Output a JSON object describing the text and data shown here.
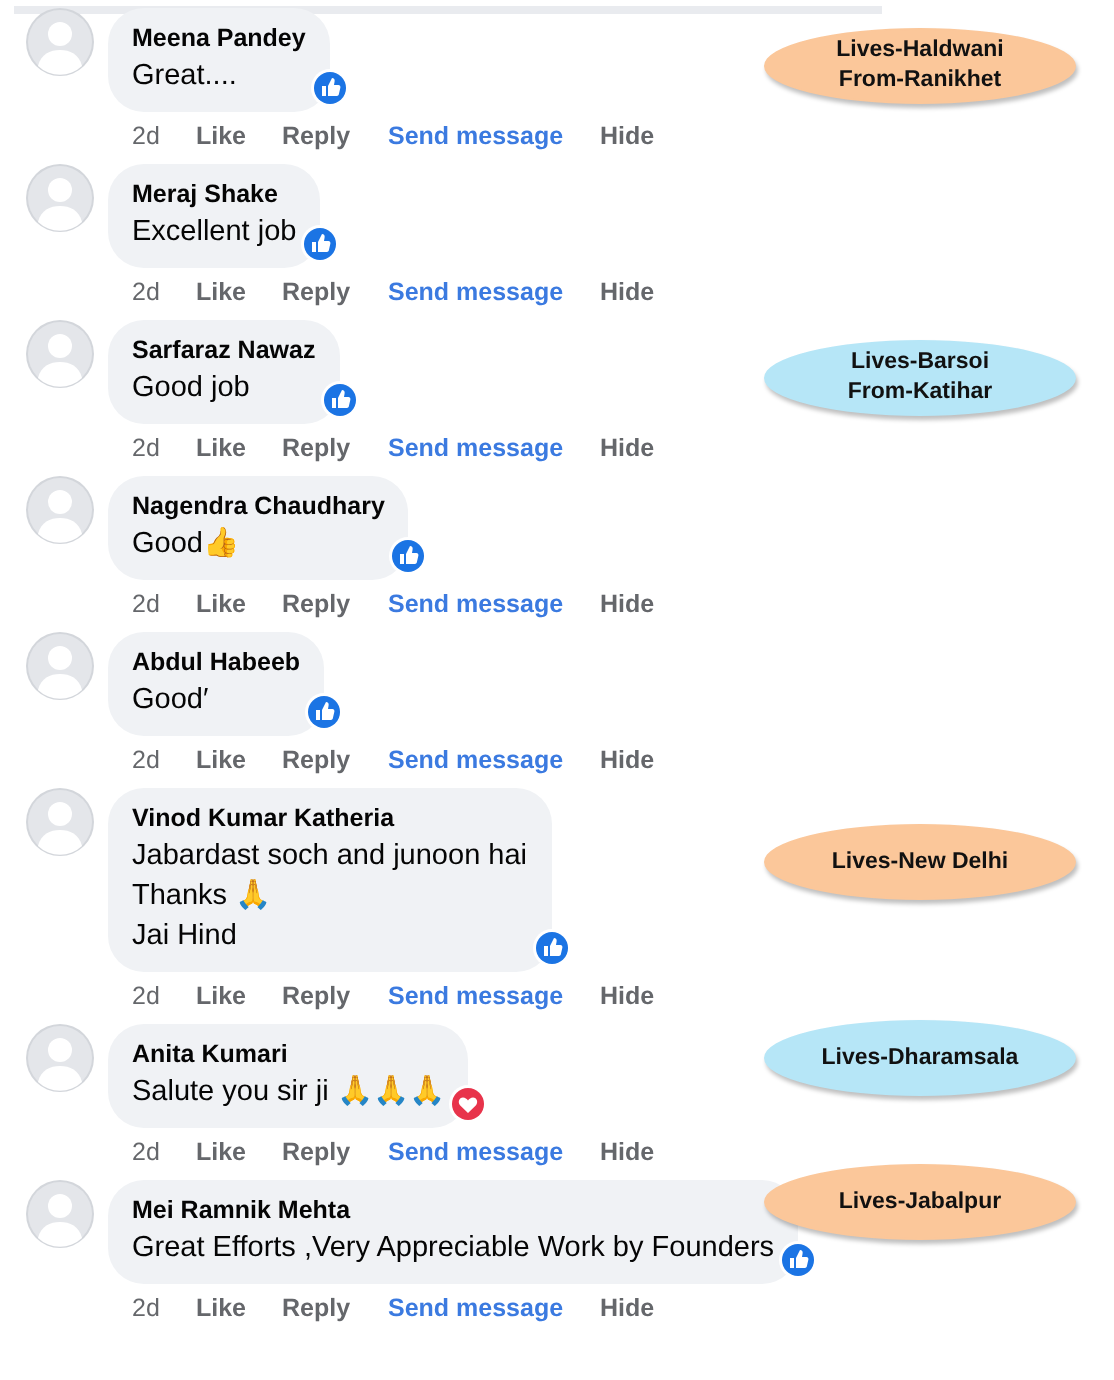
{
  "comments": [
    {
      "author": "Meena Pandey",
      "lines": [
        "Great...."
      ],
      "reaction": {
        "kind": "like"
      },
      "actions": {
        "time": "2d",
        "like": "Like",
        "reply": "Reply",
        "message": "Send message",
        "hide": "Hide"
      },
      "callout": {
        "lines": [
          "Lives-Haldwani",
          "From-Ranikhet"
        ],
        "color": "#fbc79a"
      }
    },
    {
      "author": "Meraj Shake",
      "lines": [
        "Excellent job"
      ],
      "reaction": {
        "kind": "like"
      },
      "actions": {
        "time": "2d",
        "like": "Like",
        "reply": "Reply",
        "message": "Send message",
        "hide": "Hide"
      }
    },
    {
      "author": "Sarfaraz Nawaz",
      "lines": [
        "Good job"
      ],
      "reaction": {
        "kind": "like"
      },
      "actions": {
        "time": "2d",
        "like": "Like",
        "reply": "Reply",
        "message": "Send message",
        "hide": "Hide"
      },
      "callout": {
        "lines": [
          "Lives-Barsoi",
          "From-Katihar"
        ],
        "color": "#b6e6f7"
      }
    },
    {
      "author": "Nagendra Chaudhary",
      "lines": [
        "Good👍"
      ],
      "reaction": {
        "kind": "like"
      },
      "actions": {
        "time": "2d",
        "like": "Like",
        "reply": "Reply",
        "message": "Send message",
        "hide": "Hide"
      }
    },
    {
      "author": "Abdul Habeeb",
      "lines": [
        "Good′"
      ],
      "reaction": {
        "kind": "like"
      },
      "actions": {
        "time": "2d",
        "like": "Like",
        "reply": "Reply",
        "message": "Send message",
        "hide": "Hide"
      }
    },
    {
      "author": "Vinod Kumar Katheria",
      "lines": [
        "Jabardast soch and junoon hai",
        "Thanks 🙏",
        "Jai Hind"
      ],
      "reaction": {
        "kind": "like"
      },
      "actions": {
        "time": "2d",
        "like": "Like",
        "reply": "Reply",
        "message": "Send message",
        "hide": "Hide"
      },
      "callout": {
        "lines": [
          "Lives-New Delhi"
        ],
        "color": "#fbc79a"
      }
    },
    {
      "author": "Anita Kumari",
      "lines": [
        "Salute you sir ji 🙏🙏🙏"
      ],
      "reaction": {
        "kind": "love"
      },
      "actions": {
        "time": "2d",
        "like": "Like",
        "reply": "Reply",
        "message": "Send message",
        "hide": "Hide"
      },
      "callout": {
        "lines": [
          "Lives-Dharamsala"
        ],
        "color": "#b6e6f7"
      }
    },
    {
      "author": "Mei Ramnik Mehta",
      "lines": [
        "Great Efforts ,Very Appreciable Work by Founders"
      ],
      "reaction": {
        "kind": "like"
      },
      "actions": {
        "time": "2d",
        "like": "Like",
        "reply": "Reply",
        "message": "Send message",
        "hide": "Hide"
      },
      "callout": {
        "lines": [
          "Lives-Jabalpur"
        ],
        "color": "#fbc79a"
      }
    }
  ]
}
